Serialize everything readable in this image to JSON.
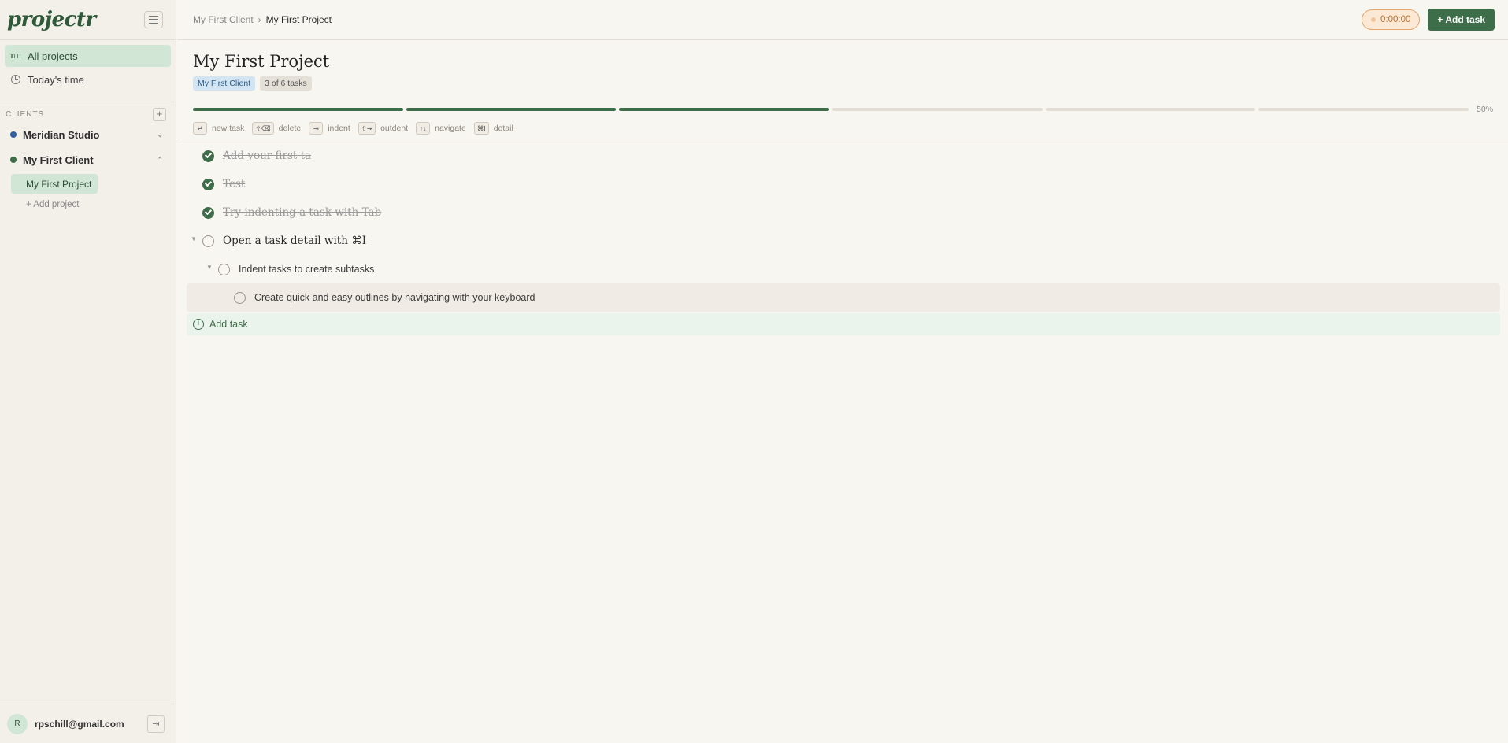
{
  "app": {
    "logo": "projectr"
  },
  "sidebar": {
    "nav": [
      {
        "label": "All projects",
        "icon": "grid-icon",
        "active": true
      },
      {
        "label": "Today's time",
        "icon": "clock-icon",
        "active": false
      }
    ],
    "clients_label": "CLIENTS",
    "clients": [
      {
        "name": "Meridian Studio",
        "color": "#2f5f9e",
        "expanded": false
      },
      {
        "name": "My First Client",
        "color": "#3e6d4a",
        "expanded": true,
        "projects": [
          "My First Project"
        ]
      }
    ],
    "add_project": "+ Add project",
    "user": {
      "initial": "R",
      "email": "rpschill@gmail.com"
    }
  },
  "topbar": {
    "breadcrumb": [
      "My First Client",
      "My First Project"
    ],
    "timer": "0:00:00",
    "add_task": "+ Add task"
  },
  "project": {
    "title": "My First Project",
    "client_badge": "My First Client",
    "count_badge": "3 of 6 tasks",
    "progress_percent": 50,
    "progress_label": "50%",
    "progress_segments_done": 3,
    "progress_segments_total": 6
  },
  "shortcuts": [
    {
      "key": "↵",
      "label": "new task"
    },
    {
      "key": "⇧⌫",
      "label": "delete"
    },
    {
      "key": "⇥",
      "label": "indent"
    },
    {
      "key": "⇧⇥",
      "label": "outdent"
    },
    {
      "key": "↑↓",
      "label": "navigate"
    },
    {
      "key": "⌘I",
      "label": "detail"
    }
  ],
  "tasks": [
    {
      "text": "Add your first ta",
      "done": true,
      "level": 0
    },
    {
      "text": "Test",
      "done": true,
      "level": 0
    },
    {
      "text": "Try indenting a task with Tab",
      "done": true,
      "level": 0
    },
    {
      "text": "Open a task detail with ⌘I",
      "done": false,
      "level": 0,
      "collapsible": true
    },
    {
      "text": "Indent tasks to create subtasks",
      "done": false,
      "level": 1,
      "collapsible": true
    },
    {
      "text": "Create quick and easy outlines by navigating with your keyboard",
      "done": false,
      "level": 2,
      "highlight": true
    }
  ],
  "add_task_row": "Add task"
}
